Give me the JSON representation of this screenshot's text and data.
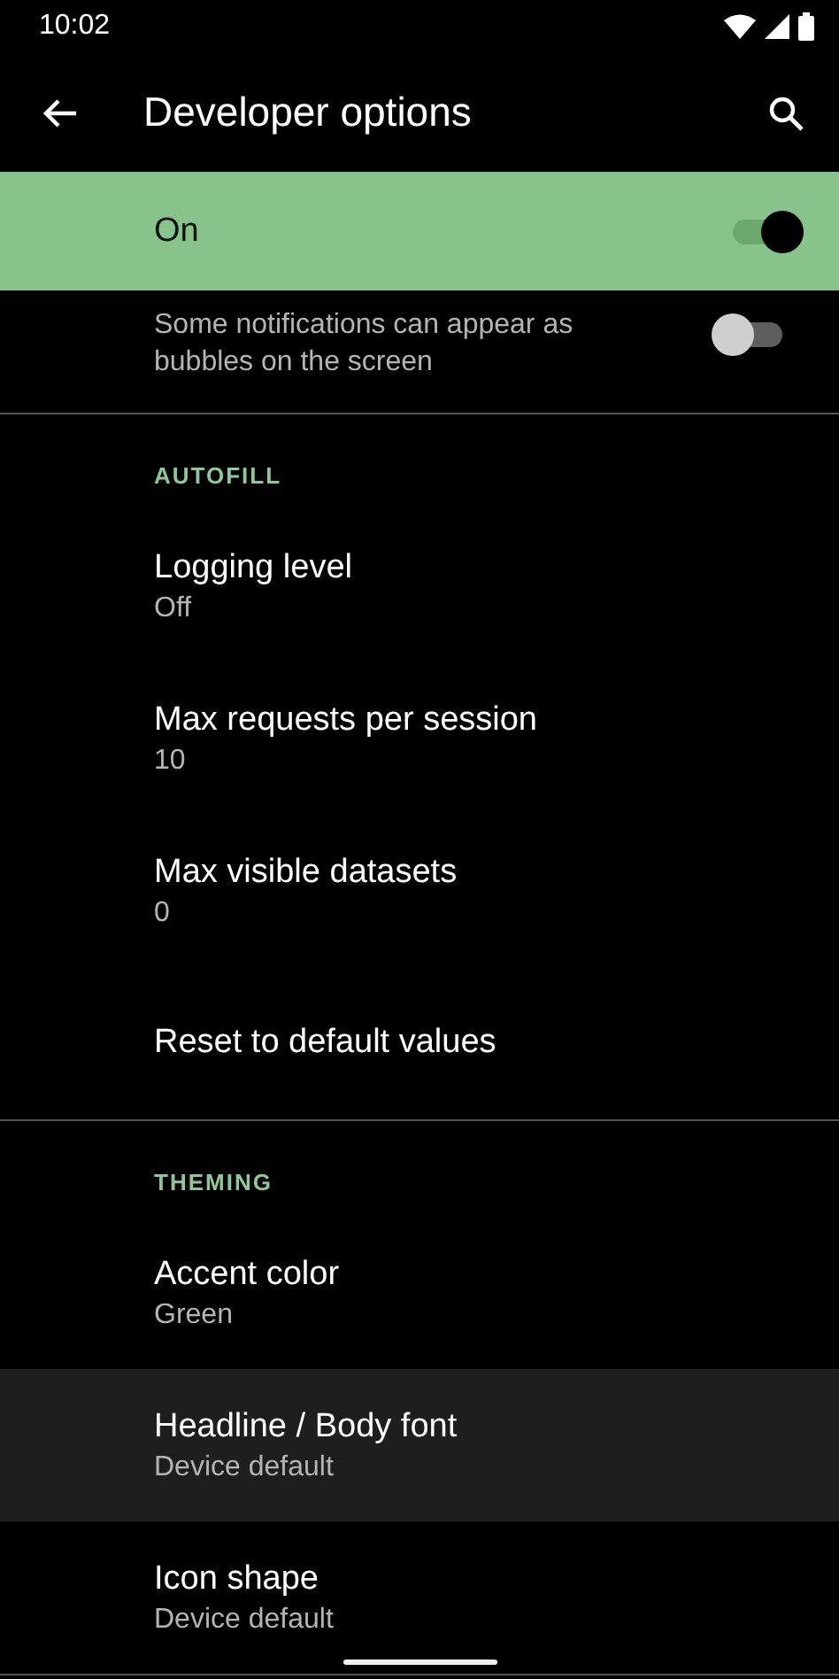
{
  "status_bar": {
    "time": "10:02"
  },
  "app_bar": {
    "title": "Developer options"
  },
  "master_switch": {
    "label": "On",
    "on": true
  },
  "bubbles": {
    "summary": "Some notifications can appear as bubbles on the screen",
    "on": false
  },
  "sections": [
    {
      "header": "AUTOFILL",
      "items": [
        {
          "title": "Logging level",
          "summary": "Off",
          "selected": false
        },
        {
          "title": "Max requests per session",
          "summary": "10",
          "selected": false
        },
        {
          "title": "Max visible datasets",
          "summary": "0",
          "selected": false
        },
        {
          "title": "Reset to default values",
          "selected": false
        }
      ]
    },
    {
      "header": "THEMING",
      "items": [
        {
          "title": "Accent color",
          "summary": "Green",
          "selected": false
        },
        {
          "title": "Headline / Body font",
          "summary": "Device default",
          "selected": true
        },
        {
          "title": "Icon shape",
          "summary": "Device default",
          "selected": false
        }
      ]
    }
  ]
}
